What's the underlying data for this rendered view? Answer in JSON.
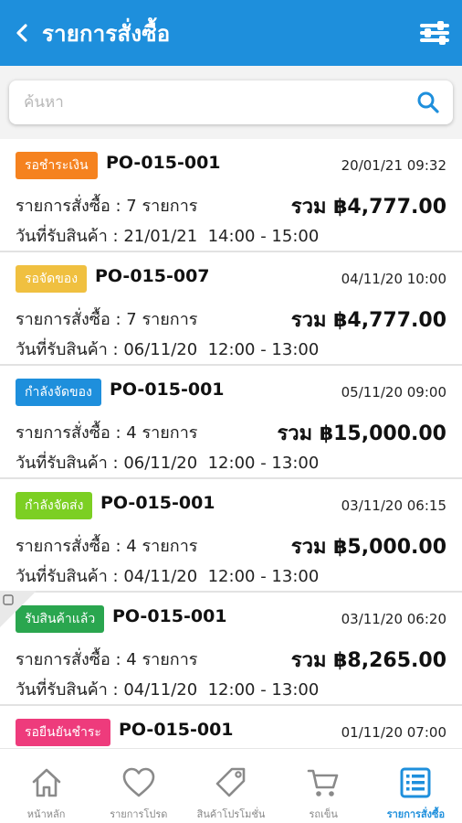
{
  "header": {
    "title": "รายการสั่งซื้อ"
  },
  "search": {
    "placeholder": "ค้นหา"
  },
  "orders": [
    {
      "status": "รอชำระเงิน",
      "status_color": "#f5821f",
      "po": "PO-015-001",
      "datetime": "20/01/21 09:32",
      "items_text": "รายการสั่งซื้อ : 7 รายการ",
      "total_text": "รวม ฿4,777.00",
      "delivery_text": "วันที่รับสินค้า : 21/01/21  14:00 - 15:00"
    },
    {
      "status": "รอจัดของ",
      "status_color": "#f0c040",
      "po": "PO-015-007",
      "datetime": "04/11/20 10:00",
      "items_text": "รายการสั่งซื้อ : 7 รายการ",
      "total_text": "รวม ฿4,777.00",
      "delivery_text": "วันที่รับสินค้า : 06/11/20  12:00 - 13:00"
    },
    {
      "status": "กำลังจัดของ",
      "status_color": "#1e8fdc",
      "po": "PO-015-001",
      "datetime": "05/11/20 09:00",
      "items_text": "รายการสั่งซื้อ : 4 รายการ",
      "total_text": "รวม ฿15,000.00",
      "delivery_text": "วันที่รับสินค้า : 06/11/20  12:00 - 13:00"
    },
    {
      "status": "กำลังจัดส่ง",
      "status_color": "#7ccf23",
      "po": "PO-015-001",
      "datetime": "03/11/20 06:15",
      "items_text": "รายการสั่งซื้อ : 4 รายการ",
      "total_text": "รวม ฿5,000.00",
      "delivery_text": "วันที่รับสินค้า : 04/11/20  12:00 - 13:00"
    },
    {
      "status": "รับสินค้าแล้ว",
      "status_color": "#2aa64f",
      "po": "PO-015-001",
      "datetime": "03/11/20 06:20",
      "items_text": "รายการสั่งซื้อ : 4 รายการ",
      "total_text": "รวม ฿8,265.00",
      "delivery_text": "วันที่รับสินค้า : 04/11/20  12:00 - 13:00"
    },
    {
      "status": "รอยืนยันชำระ",
      "status_color": "#ee3b7c",
      "po": "PO-015-001",
      "datetime": "01/11/20 07:00",
      "items_text": "",
      "total_text": "",
      "delivery_text": ""
    }
  ],
  "tabs": [
    {
      "label": "หน้าหลัก",
      "icon": "home-icon"
    },
    {
      "label": "รายการโปรด",
      "icon": "heart-icon"
    },
    {
      "label": "สินค้าโปรโมชั่น",
      "icon": "tag-icon"
    },
    {
      "label": "รถเข็น",
      "icon": "cart-icon"
    },
    {
      "label": "รายการสั่งซื้อ",
      "icon": "order-list-icon",
      "active": true
    }
  ],
  "colors": {
    "primary": "#1e8fdc",
    "inactive": "#8a8a8a"
  }
}
